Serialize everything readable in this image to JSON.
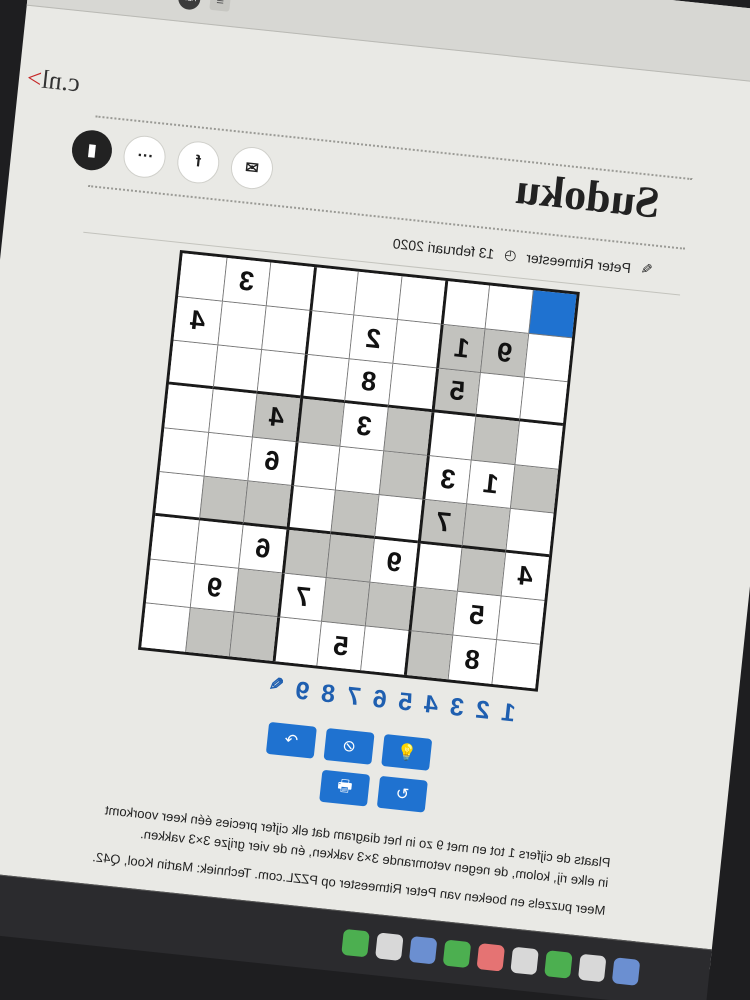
{
  "browser": {
    "extension_label": "ABP",
    "menu_icon": "menu-icon"
  },
  "site": {
    "domain_fragment": "c.nl",
    "chevron": ">"
  },
  "article": {
    "title": "Sudoku",
    "author": "Peter Ritmeester",
    "date": "13 februari 2020",
    "share": [
      "mail-icon",
      "facebook-icon",
      "more-icon",
      "bookmark-icon"
    ],
    "share_glyphs": [
      "✉",
      "f",
      "···",
      "▮"
    ]
  },
  "sudoku": {
    "selected_cell": [
      0,
      0
    ],
    "rows": [
      [
        "",
        "",
        "",
        "",
        "",
        "",
        "",
        "3",
        ""
      ],
      [
        "",
        "9",
        "1",
        "",
        "2",
        "",
        "",
        "",
        "4"
      ],
      [
        "",
        "",
        "5",
        "",
        "8",
        "",
        "",
        "",
        ""
      ],
      [
        "",
        "",
        "",
        "",
        "3",
        "",
        "4",
        "",
        ""
      ],
      [
        "",
        "1",
        "3",
        "",
        "",
        "",
        "6",
        "",
        ""
      ],
      [
        "",
        "",
        "7",
        "",
        "",
        "",
        "",
        "",
        ""
      ],
      [
        "4",
        "",
        "",
        "9",
        "",
        "",
        "6",
        "",
        ""
      ],
      [
        "",
        "5",
        "",
        "",
        "",
        "7",
        "",
        "9",
        ""
      ],
      [
        "",
        "8",
        "",
        "",
        "5",
        "",
        "",
        "",
        ""
      ]
    ],
    "gray_cells": [
      [
        1,
        1
      ],
      [
        1,
        2
      ],
      [
        2,
        2
      ],
      [
        3,
        1
      ],
      [
        3,
        3
      ],
      [
        3,
        5
      ],
      [
        3,
        6
      ],
      [
        4,
        0
      ],
      [
        4,
        3
      ],
      [
        5,
        1
      ],
      [
        5,
        2
      ],
      [
        5,
        4
      ],
      [
        5,
        6
      ],
      [
        5,
        7
      ],
      [
        6,
        1
      ],
      [
        6,
        4
      ],
      [
        6,
        5
      ],
      [
        7,
        2
      ],
      [
        7,
        3
      ],
      [
        7,
        4
      ],
      [
        7,
        6
      ],
      [
        8,
        2
      ],
      [
        8,
        6
      ],
      [
        8,
        7
      ]
    ]
  },
  "number_bar": {
    "digits": [
      "1",
      "2",
      "3",
      "4",
      "5",
      "6",
      "7",
      "8",
      "9"
    ],
    "pen_icon": "pencil-icon"
  },
  "controls": [
    {
      "name": "hint-button",
      "glyph": "💡"
    },
    {
      "name": "hide-button",
      "glyph": "⊘"
    },
    {
      "name": "redo-button",
      "glyph": "↷"
    },
    {
      "name": "reset-button",
      "glyph": "↻"
    },
    {
      "name": "print-button",
      "glyph": "🖶"
    }
  ],
  "instructions": {
    "text": "Plaats de cijfers 1 tot en met 9 zo in het diagram dat elk cijfer precies één keer voorkomt in elke rij, kolom, de negen vetomrande 3×3 vakken, én de vier grijze 3×3 vakken.",
    "credits": "Meer puzzels en boeken van Peter Ritmeester op PZZL.com. Techniek: Martin Kool, Q42."
  },
  "dock": {
    "apps": [
      "finder",
      "safari",
      "mail",
      "messages",
      "maps",
      "photos",
      "notes",
      "music",
      "settings"
    ]
  }
}
